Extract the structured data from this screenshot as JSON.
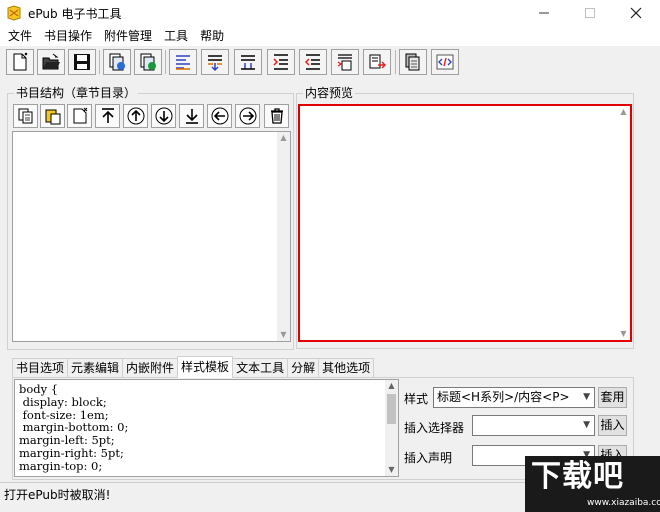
{
  "window": {
    "title": "ePub 电子书工具"
  },
  "menu": [
    "文件",
    "书目操作",
    "附件管理",
    "工具",
    "帮助"
  ],
  "toolbar": {
    "groups": [
      [
        "new-file-icon",
        "open-folder-icon",
        "save-disk-icon"
      ],
      [
        "import-icon",
        "export-icon"
      ],
      [
        "align-list-icon",
        "move-items-up-icon",
        "move-items-down-icon",
        "indent-icon",
        "outdent-icon",
        "page-list-icon",
        "page-export-icon"
      ],
      [
        "copy-pages-icon",
        "code-tag-icon"
      ]
    ]
  },
  "structure": {
    "label": "书目结构（章节目录）",
    "buttons": [
      "copy-icon",
      "paste-icon",
      "new-page-icon",
      "move-top-icon",
      "move-up-icon",
      "move-down-icon",
      "move-bottom-icon",
      "move-left-icon",
      "move-right-icon",
      "delete-icon"
    ]
  },
  "preview": {
    "label": "内容预览",
    "highlight_color": "#e00000"
  },
  "tabs": {
    "items": [
      "书目选项",
      "元素编辑",
      "内嵌附件",
      "样式模板",
      "文本工具",
      "分解",
      "其他选项"
    ],
    "active": "样式模板"
  },
  "style_editor": {
    "code": "body {\n display: block;\n font-size: 1em;\n margin-bottom: 0;\nmargin-left: 5pt;\nmargin-right: 5pt;\nmargin-top: 0;"
  },
  "style_panel": {
    "style_label": "样式",
    "style_value": "标题<H系列>/内容<P>",
    "apply_button": "套用",
    "selector_label": "插入选择器",
    "selector_button": "插入",
    "declaration_label": "插入声明",
    "declaration_button": "插入"
  },
  "status": {
    "text": "打开ePub时被取消!"
  },
  "watermark": {
    "title": "下载吧",
    "url": "www.xiazaiba.com"
  }
}
